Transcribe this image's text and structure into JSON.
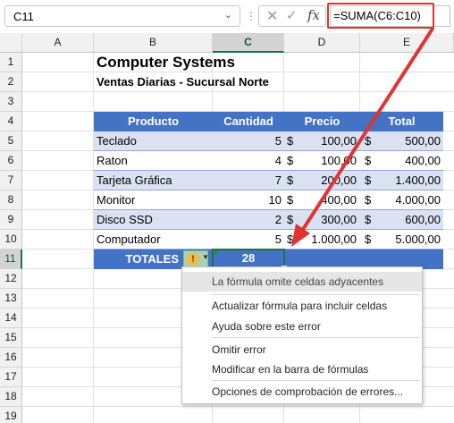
{
  "namebox": {
    "value": "C11"
  },
  "formula_bar": {
    "formula": "=SUMA(C6:C10)"
  },
  "columns": [
    "A",
    "B",
    "C",
    "D",
    "E"
  ],
  "rows": [
    "1",
    "2",
    "3",
    "4",
    "5",
    "6",
    "7",
    "8",
    "9",
    "10",
    "11",
    "12",
    "13",
    "14",
    "15",
    "16",
    "17",
    "18",
    "19"
  ],
  "sheet": {
    "title": "Computer Systems",
    "subtitle": "Ventas Diarias - Sucursal Norte",
    "headers": [
      "Producto",
      "Cantidad",
      "Precio",
      "Total"
    ],
    "data_rows": [
      {
        "producto": "Teclado",
        "cantidad": "5",
        "precio_sym": "$",
        "precio": "100,00",
        "total_sym": "$",
        "total": "500,00"
      },
      {
        "producto": "Raton",
        "cantidad": "4",
        "precio_sym": "$",
        "precio": "100,00",
        "total_sym": "$",
        "total": "400,00"
      },
      {
        "producto": "Tarjeta Gráfica",
        "cantidad": "7",
        "precio_sym": "$",
        "precio": "200,00",
        "total_sym": "$",
        "total": "1.400,00"
      },
      {
        "producto": "Monitor",
        "cantidad": "10",
        "precio_sym": "$",
        "precio": "400,00",
        "total_sym": "$",
        "total": "4.000,00"
      },
      {
        "producto": "Disco SSD",
        "cantidad": "2",
        "precio_sym": "$",
        "precio": "300,00",
        "total_sym": "$",
        "total": "600,00"
      },
      {
        "producto": "Computador",
        "cantidad": "5",
        "precio_sym": "$",
        "precio": "1.000,00",
        "total_sym": "$",
        "total": "5.000,00"
      }
    ],
    "totals_label": "TOTALES",
    "totals_value": "28"
  },
  "error_menu": {
    "header": "La fórmula omite celdas adyacentes",
    "items": [
      "Actualizar fórmula para incluir celdas",
      "Ayuda sobre este error",
      "Omitir error",
      "Modificar en la barra de fórmulas",
      "Opciones de comprobación de errores..."
    ]
  },
  "colors": {
    "table_header": "#4472c4",
    "band": "#d9e1f2",
    "selection": "#217346",
    "annotation_arrow": "#e03434"
  },
  "icons": [
    "cancel-icon",
    "enter-icon",
    "function-icon",
    "error-warning-icon",
    "dropdown-caret-icon"
  ]
}
